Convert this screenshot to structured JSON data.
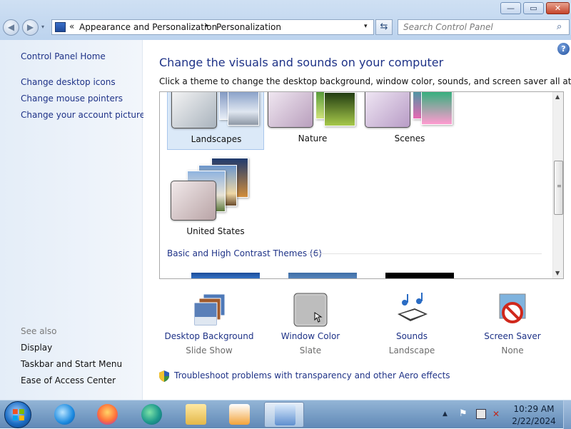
{
  "window": {
    "controls": {
      "minimize": "—",
      "maximize": "▭",
      "close": "✕"
    }
  },
  "nav": {
    "back": "◀",
    "forward": "▶"
  },
  "address": {
    "prefix": "«",
    "crumbs": [
      "Appearance and Personalization",
      "Personalization"
    ],
    "separator": "▸",
    "dropdown": "▾"
  },
  "search": {
    "placeholder": "Search Control Panel"
  },
  "sidebar": {
    "home": "Control Panel Home",
    "links": [
      "Change desktop icons",
      "Change mouse pointers",
      "Change your account picture"
    ],
    "see_also_heading": "See also",
    "see_also": [
      "Display",
      "Taskbar and Start Menu",
      "Ease of Access Center"
    ]
  },
  "main": {
    "help": "?",
    "title": "Change the visuals and sounds on your computer",
    "subtitle": "Click a theme to change the desktop background, window color, sounds, and screen saver all at once.",
    "themes": [
      {
        "name": "Landscapes",
        "selected": true
      },
      {
        "name": "Nature",
        "selected": false
      },
      {
        "name": "Scenes",
        "selected": false
      },
      {
        "name": "United States",
        "selected": false
      }
    ],
    "basic_group": "Basic and High Contrast Themes (6)",
    "bottom_items": [
      {
        "label": "Desktop Background",
        "value": "Slide Show",
        "icon": "desktop-background-icon"
      },
      {
        "label": "Window Color",
        "value": "Slate",
        "icon": "window-color-icon"
      },
      {
        "label": "Sounds",
        "value": "Landscape",
        "icon": "sounds-icon"
      },
      {
        "label": "Screen Saver",
        "value": "None",
        "icon": "screen-saver-icon"
      }
    ],
    "troubleshoot": "Troubleshoot problems with transparency and other Aero effects"
  },
  "taskbar": {
    "apps": [
      "internet-explorer-icon",
      "firefox-icon",
      "edge-icon",
      "file-explorer-icon",
      "media-player-icon",
      "control-panel-icon"
    ],
    "clock": {
      "time": "10:29 AM",
      "date": "2/22/2024"
    }
  },
  "colors": {
    "link": "#1e3287",
    "selected_theme": "#dbe9f8",
    "taskbar": "#5f88b6"
  }
}
